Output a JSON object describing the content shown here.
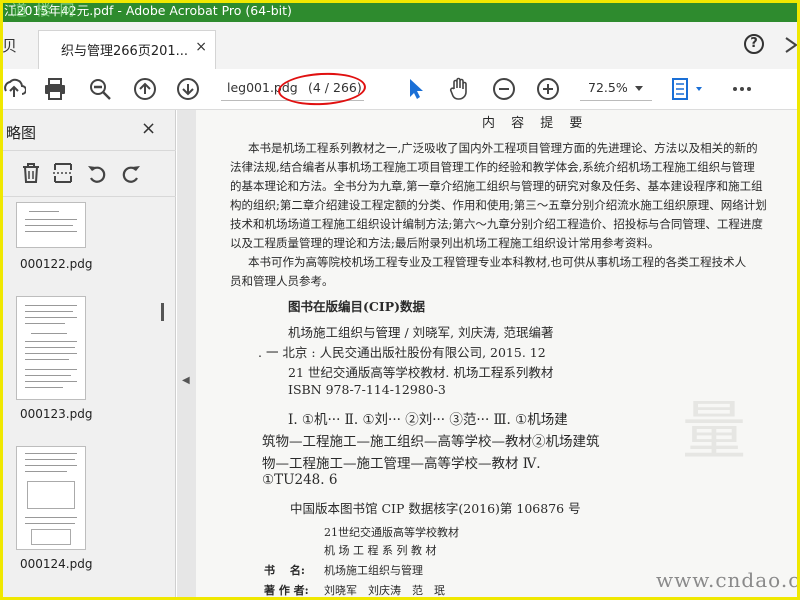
{
  "window": {
    "title": "江2015年42元.pdf - Adobe Acrobat Pro (64-bit)",
    "watermark": "道 楼 网"
  },
  "tabs": {
    "stub_label": "贝",
    "active_label": "织与管理266页201...",
    "close_glyph": "×"
  },
  "toolbar": {
    "filename": "leg001.pdg",
    "page_indicator": "(4 / 266)",
    "zoom": "72.5%",
    "icons": [
      "upload-icon",
      "print-icon",
      "zoom-out-icon",
      "page-up-icon",
      "page-down-icon",
      "select-cursor-icon",
      "hand-icon",
      "minus-zoom-icon",
      "plus-zoom-icon",
      "fit-page-icon",
      "more-icon"
    ]
  },
  "panel": {
    "title": "略图",
    "close_glyph": "×",
    "thumbnails": [
      {
        "label": "000122.pdg"
      },
      {
        "label": "000123.pdg"
      },
      {
        "label": "000124.pdg"
      }
    ]
  },
  "document": {
    "heading": "内 容 提 要",
    "paragraphs": [
      "本书是机场工程系列教材之一,广泛吸收了国内外工程项目管理方面的先进理论、方法以及相关的新的",
      "法律法规,结合编者从事机场工程施工项目管理工作的经验和教学体会,系统介绍机场工程施工组织与管理",
      "的基本理论和方法。全书分为九章,第一章介绍施工组织与管理的研究对象及任务、基本建设程序和施工组",
      "构的组织;第二章介绍建设工程定额的分类、作用和使用;第三～五章分别介绍流水施工组织原理、网络计划",
      "技术和机场场道工程施工组织设计编制方法;第六～九章分别介绍工程造价、招投标与合同管理、工程进度",
      "以及工程质量管理的理论和方法;最后附录列出机场工程施工组织设计常用参考资料。",
      "本书可作为高等院校机场工程专业及工程管理专业本科教材,也可供从事机场工程的各类工程技术人",
      "员和管理人员参考。"
    ],
    "cip_title": "图书在版编目(CIP)数据",
    "cip_lines": [
      "机场施工组织与管理 / 刘晓军, 刘庆涛, 范珉编著",
      ". 一 北京 : 人民交通出版社股份有限公司, 2015. 12",
      "21 世纪交通版高等学校教材. 机场工程系列教材",
      "ISBN 978-7-114-12980-3"
    ],
    "classification_lines": [
      "Ⅰ. ①机···  Ⅱ. ①刘···  ②刘···  ③范···   Ⅲ. ①机场建",
      "筑物—工程施工—施工组织—高等学校—教材②机场建筑",
      "物—工程施工—施工管理—高等学校—教材   Ⅳ.",
      "①TU248. 6"
    ],
    "cip_core": "中国版本图书馆 CIP 数据核字(2016)第 106876 号",
    "series_line1": "21世纪交通版高等学校教材",
    "series_line2": "机 场 工 程 系 列 教 材",
    "book_label": "书　 名:",
    "book_name": "机场施工组织与管理",
    "author_label": "著 作 者:",
    "authors": "刘晓军　刘庆涛　范　珉"
  },
  "footer_watermark": "www.cndao.com",
  "colors": {
    "titlebar": "#2e8b2e",
    "frame": "#f0e800",
    "accent_blue": "#1a6fd6",
    "annotation_red": "#e01010"
  }
}
